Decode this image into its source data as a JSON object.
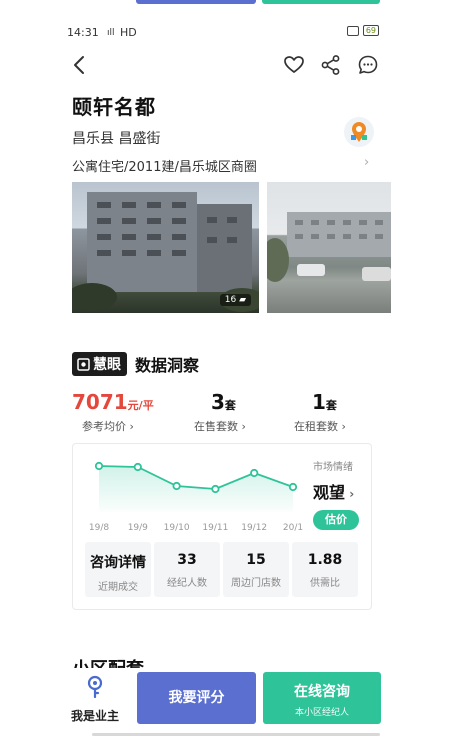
{
  "status_bar": {
    "time": "14:31",
    "network": "HD",
    "battery": "69"
  },
  "property": {
    "name": "颐轩名都",
    "address": "昌乐县 昌盛街",
    "type_line": "公寓住宅/2011建/昌乐城区商圈",
    "photo_count": "16"
  },
  "insight": {
    "badge": "慧眼",
    "title": "数据洞察",
    "price": {
      "value": "7071",
      "unit": "元/平",
      "label": "参考均价"
    },
    "on_sale": {
      "value": "3",
      "unit": "套",
      "label": "在售套数"
    },
    "for_rent": {
      "value": "1",
      "unit": "套",
      "label": "在租套数"
    },
    "market_mood": {
      "label": "市场情绪",
      "value": "观望",
      "button": "估价"
    },
    "metrics": [
      {
        "value": "咨询详情",
        "label": "近期成交"
      },
      {
        "value": "33",
        "label": "经纪人数"
      },
      {
        "value": "15",
        "label": "周边门店数"
      },
      {
        "value": "1.88",
        "label": "供需比"
      }
    ]
  },
  "chart_data": {
    "type": "line",
    "categories": [
      "19/8",
      "19/9",
      "19/10",
      "19/11",
      "19/12",
      "20/1"
    ],
    "series": [
      {
        "values": [
          0.92,
          0.9,
          0.52,
          0.46,
          0.78,
          0.5
        ]
      }
    ],
    "title": "",
    "xlabel": "",
    "ylabel": "",
    "grid": false,
    "color": "#2fc39a"
  },
  "section_peek": "小区配套",
  "bottom": {
    "owner_label": "我是业主",
    "rate_label": "我要评分",
    "consult_label": "在线咨询",
    "consult_sub": "本小区经纪人"
  },
  "colors": {
    "accent_green": "#2fc39a",
    "accent_blue": "#5a6fcf",
    "price_red": "#e4473b"
  }
}
